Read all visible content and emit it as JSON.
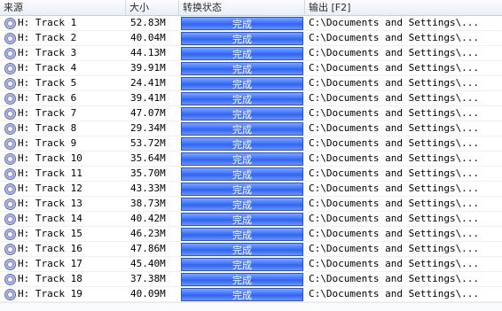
{
  "columns": {
    "source": "来源",
    "size": "大小",
    "status": "转换状态",
    "output": "输出 [F2]"
  },
  "rows": [
    {
      "source": "H: Track 1",
      "size": "52.83M",
      "status": "完成",
      "output": "C:\\Documents and Settings\\..."
    },
    {
      "source": "H: Track 2",
      "size": "40.04M",
      "status": "完成",
      "output": "C:\\Documents and Settings\\..."
    },
    {
      "source": "H: Track 3",
      "size": "44.13M",
      "status": "完成",
      "output": "C:\\Documents and Settings\\..."
    },
    {
      "source": "H: Track 4",
      "size": "39.91M",
      "status": "完成",
      "output": "C:\\Documents and Settings\\..."
    },
    {
      "source": "H: Track 5",
      "size": "24.41M",
      "status": "完成",
      "output": "C:\\Documents and Settings\\..."
    },
    {
      "source": "H: Track 6",
      "size": "39.41M",
      "status": "完成",
      "output": "C:\\Documents and Settings\\..."
    },
    {
      "source": "H: Track 7",
      "size": "47.07M",
      "status": "完成",
      "output": "C:\\Documents and Settings\\..."
    },
    {
      "source": "H: Track 8",
      "size": "29.34M",
      "status": "完成",
      "output": "C:\\Documents and Settings\\..."
    },
    {
      "source": "H: Track 9",
      "size": "53.72M",
      "status": "完成",
      "output": "C:\\Documents and Settings\\..."
    },
    {
      "source": "H: Track 10",
      "size": "35.64M",
      "status": "完成",
      "output": "C:\\Documents and Settings\\..."
    },
    {
      "source": "H: Track 11",
      "size": "35.70M",
      "status": "完成",
      "output": "C:\\Documents and Settings\\..."
    },
    {
      "source": "H: Track 12",
      "size": "43.33M",
      "status": "完成",
      "output": "C:\\Documents and Settings\\..."
    },
    {
      "source": "H: Track 13",
      "size": "38.73M",
      "status": "完成",
      "output": "C:\\Documents and Settings\\..."
    },
    {
      "source": "H: Track 14",
      "size": "40.42M",
      "status": "完成",
      "output": "C:\\Documents and Settings\\..."
    },
    {
      "source": "H: Track 15",
      "size": "46.23M",
      "status": "完成",
      "output": "C:\\Documents and Settings\\..."
    },
    {
      "source": "H: Track 16",
      "size": "47.86M",
      "status": "完成",
      "output": "C:\\Documents and Settings\\..."
    },
    {
      "source": "H: Track 17",
      "size": "45.40M",
      "status": "完成",
      "output": "C:\\Documents and Settings\\..."
    },
    {
      "source": "H: Track 18",
      "size": "37.38M",
      "status": "完成",
      "output": "C:\\Documents and Settings\\..."
    },
    {
      "source": "H: Track 19",
      "size": "40.09M",
      "status": "完成",
      "output": "C:\\Documents and Settings\\..."
    }
  ],
  "row_icon": "disc-icon",
  "colors": {
    "progress_fill": "#3f73f3",
    "progress_text": "#ffffff",
    "header_bg": "#e9eef6"
  }
}
